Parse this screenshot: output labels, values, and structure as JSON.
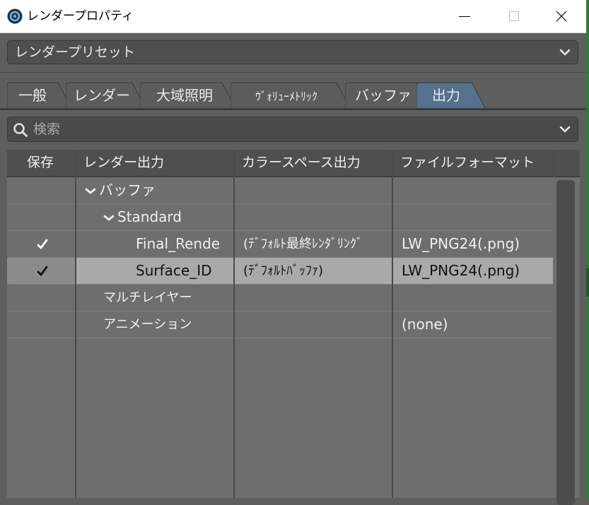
{
  "window": {
    "title": "レンダープロパティ"
  },
  "preset": {
    "value": "レンダープリセット"
  },
  "tabs": [
    {
      "label": "一般"
    },
    {
      "label": "レンダー"
    },
    {
      "label": "大域照明"
    },
    {
      "label": "ｳﾞｫﾘｭｰﾒﾄﾘｯｸ"
    },
    {
      "label": "バッファ"
    },
    {
      "label": "出力",
      "active": true
    }
  ],
  "search": {
    "placeholder": "検索"
  },
  "table": {
    "columns": [
      "保存",
      "レンダー出力",
      "カラースペース出力",
      "ファイルフォーマット"
    ],
    "rows": [
      {
        "save": "",
        "name": "バッファ",
        "colorspace": "",
        "format": ""
      },
      {
        "save": "",
        "name": "Standard",
        "colorspace": "",
        "format": ""
      },
      {
        "save": "✔",
        "name": "Final_Rende",
        "colorspace": "(ﾃﾞﾌｫﾙﾄ最終ﾚﾝﾀﾞﾘﾝｸﾞ",
        "format": "LW_PNG24(.png)"
      },
      {
        "save": "✔",
        "name": "Surface_ID",
        "colorspace": "(ﾃﾞﾌｫﾙﾄﾊﾞｯﾌｧ)",
        "format": "LW_PNG24(.png)",
        "selected": true
      },
      {
        "save": "",
        "name": "マルチレイヤー",
        "colorspace": "",
        "format": ""
      },
      {
        "save": "",
        "name": "アニメーション",
        "colorspace": "",
        "format": "(none)"
      }
    ]
  },
  "colors": {
    "active_tab": "#56708f",
    "selected_row": "#a9a9a9",
    "panel": "#5e5e5e"
  }
}
